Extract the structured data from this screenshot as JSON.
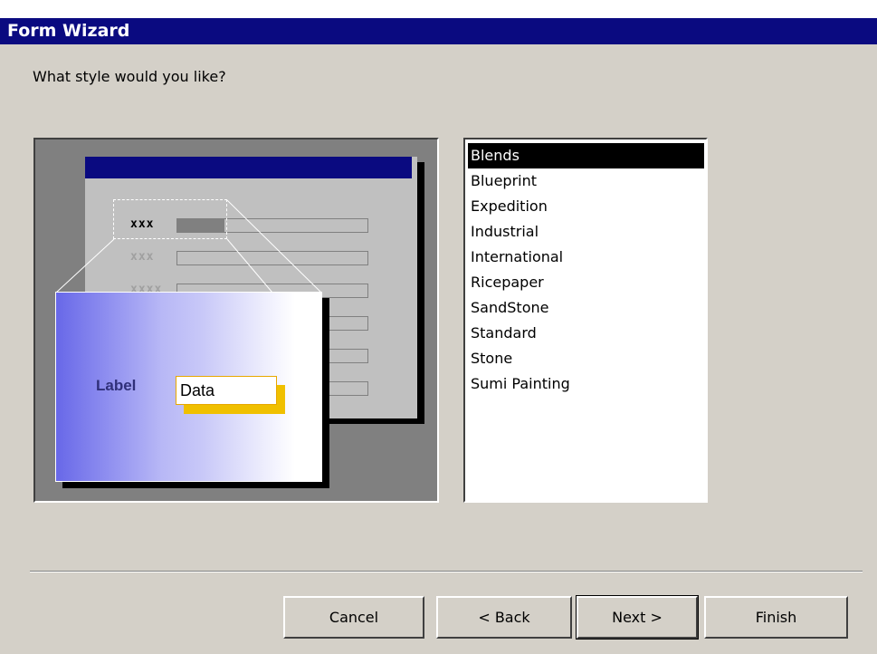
{
  "window": {
    "title": "Form Wizard"
  },
  "question": "What style would you like?",
  "preview": {
    "row_labels": [
      "xxx",
      "xxx",
      "xxxx"
    ],
    "zoom_label": "Label",
    "zoom_data": "Data"
  },
  "styles": {
    "selected": "Blends",
    "items": [
      "Blends",
      "Blueprint",
      "Expedition",
      "Industrial",
      "International",
      "Ricepaper",
      "SandStone",
      "Standard",
      "Stone",
      "Sumi Painting"
    ]
  },
  "buttons": {
    "cancel": "Cancel",
    "back": "< Back",
    "next": "Next >",
    "finish": "Finish"
  },
  "colors": {
    "titlebar": "#0a0a80",
    "dialog_bg": "#d4d0c8",
    "selection": "#000000"
  }
}
